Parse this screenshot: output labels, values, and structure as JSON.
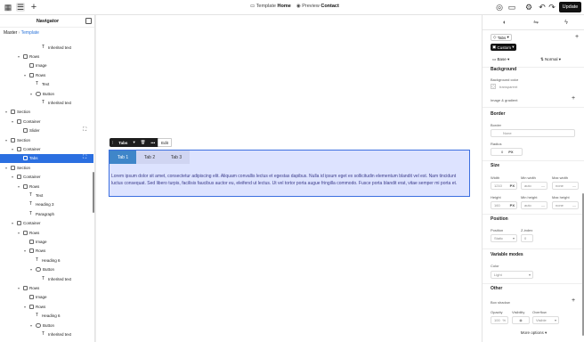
{
  "topbar": {
    "breadcrumb_left_label": "Template",
    "breadcrumb_left_value": "Home",
    "breadcrumb_right_label": "Preview",
    "breadcrumb_right_value": "Contact",
    "update_label": "Update"
  },
  "navigator": {
    "title": "Navigator",
    "crumb_root": "Master",
    "crumb_current": "Template",
    "tree": [
      {
        "label": "Inherited text",
        "depth": 5,
        "icon": "text",
        "caret": ""
      },
      {
        "label": "Rows",
        "depth": 2,
        "icon": "box",
        "caret": "▾"
      },
      {
        "label": "Image",
        "depth": 3,
        "icon": "image",
        "caret": ""
      },
      {
        "label": "Rows",
        "depth": 3,
        "icon": "box",
        "caret": "▾"
      },
      {
        "label": "Text",
        "depth": 4,
        "icon": "text",
        "caret": ""
      },
      {
        "label": "Button",
        "depth": 4,
        "icon": "button",
        "caret": "▾"
      },
      {
        "label": "Inherited text",
        "depth": 5,
        "icon": "text",
        "caret": ""
      },
      {
        "label": "Section",
        "depth": 0,
        "icon": "box",
        "caret": "▾"
      },
      {
        "label": "Container",
        "depth": 1,
        "icon": "box",
        "caret": "▾"
      },
      {
        "label": "Slider",
        "depth": 2,
        "icon": "box",
        "caret": ""
      },
      {
        "label": "Section",
        "depth": 0,
        "icon": "box",
        "caret": "▾"
      },
      {
        "label": "Container",
        "depth": 1,
        "icon": "box",
        "caret": "▾"
      },
      {
        "label": "Tabs",
        "depth": 2,
        "icon": "box",
        "caret": "",
        "selected": true
      },
      {
        "label": "Section",
        "depth": 0,
        "icon": "box",
        "caret": "▾"
      },
      {
        "label": "Container",
        "depth": 1,
        "icon": "box",
        "caret": "▾"
      },
      {
        "label": "Rows",
        "depth": 2,
        "icon": "box",
        "caret": "▾"
      },
      {
        "label": "Text",
        "depth": 3,
        "icon": "text",
        "caret": ""
      },
      {
        "label": "Heading 3",
        "depth": 3,
        "icon": "text",
        "caret": ""
      },
      {
        "label": "Paragraph",
        "depth": 3,
        "icon": "text",
        "caret": ""
      },
      {
        "label": "Container",
        "depth": 1,
        "icon": "box",
        "caret": "▾"
      },
      {
        "label": "Rows",
        "depth": 2,
        "icon": "box",
        "caret": "▾"
      },
      {
        "label": "Image",
        "depth": 3,
        "icon": "image",
        "caret": ""
      },
      {
        "label": "Rows",
        "depth": 3,
        "icon": "box",
        "caret": "▾"
      },
      {
        "label": "Heading 6",
        "depth": 4,
        "icon": "text",
        "caret": ""
      },
      {
        "label": "Button",
        "depth": 4,
        "icon": "button",
        "caret": "▾"
      },
      {
        "label": "Inherited text",
        "depth": 5,
        "icon": "text",
        "caret": ""
      },
      {
        "label": "Rows",
        "depth": 2,
        "icon": "box",
        "caret": "▾"
      },
      {
        "label": "Image",
        "depth": 3,
        "icon": "image",
        "caret": ""
      },
      {
        "label": "Rows",
        "depth": 3,
        "icon": "box",
        "caret": "▾"
      },
      {
        "label": "Heading 6",
        "depth": 4,
        "icon": "text",
        "caret": ""
      },
      {
        "label": "Button",
        "depth": 4,
        "icon": "button",
        "caret": "▾"
      },
      {
        "label": "Inherited text",
        "depth": 5,
        "icon": "text",
        "caret": ""
      }
    ]
  },
  "canvas": {
    "toolbar_label": "Tabs",
    "toolbar_edit": "Edit",
    "tabs": [
      "Tab 1",
      "Tab 2",
      "Tab 3"
    ],
    "content": "Lorem ipsum dolor sit amet, consectetur adipiscing elit. Aliquam convallis lectus et egestas dapibus. Nulla id ipsum eget ex sollicitudin elementum blandit vel est. Nam tincidunt luctus consequat. Sed libero turpis, facilisis faucibus auctor eu, eleifend ut lectus. Ut vel tortor porta augue fringilla commodo. Fusce porta blandit erat, vitae semper mi porta et."
  },
  "panel": {
    "element_chip": "Tabs",
    "style_chip": "Custom",
    "base_label": "Base",
    "state_label": "Normal",
    "background": {
      "title": "Background",
      "color_label": "Background color",
      "color_value": "transparent",
      "image_label": "Image & gradient"
    },
    "border": {
      "title": "Border",
      "border_label": "Border",
      "border_value": "None",
      "radius_label": "Radius",
      "radius_value": "0",
      "radius_unit": "PX"
    },
    "size": {
      "title": "Size",
      "width_label": "Width",
      "width_value": "1210",
      "width_unit": "PX",
      "minwidth_label": "Min width",
      "minwidth_value": "auto",
      "minwidth_unit": "—",
      "maxwidth_label": "Max width",
      "maxwidth_value": "none",
      "maxwidth_unit": "—",
      "height_label": "Height",
      "height_value": "160",
      "height_unit": "PX",
      "minheight_label": "Min height",
      "minheight_value": "auto",
      "minheight_unit": "—",
      "maxheight_label": "Max height",
      "maxheight_value": "none",
      "maxheight_unit": "—"
    },
    "position": {
      "title": "Position",
      "position_label": "Position",
      "position_value": "Static",
      "zindex_label": "Z-index",
      "zindex_value": "0"
    },
    "variable_modes": {
      "title": "Variable modes",
      "color_label": "Color",
      "color_value": "Light"
    },
    "other": {
      "title": "Other",
      "box_shadow_label": "Box shadow",
      "opacity_label": "Opacity",
      "opacity_value": "100",
      "opacity_unit": "%",
      "visibility_label": "Visibility",
      "overflow_label": "Overflow",
      "overflow_value": "Visible",
      "more_label": "More options"
    }
  },
  "colors": {
    "accent": "#2b6fe0",
    "tab_active": "#3f86c9",
    "selection_fill": "#dde3ff",
    "update_bg": "#111111"
  }
}
